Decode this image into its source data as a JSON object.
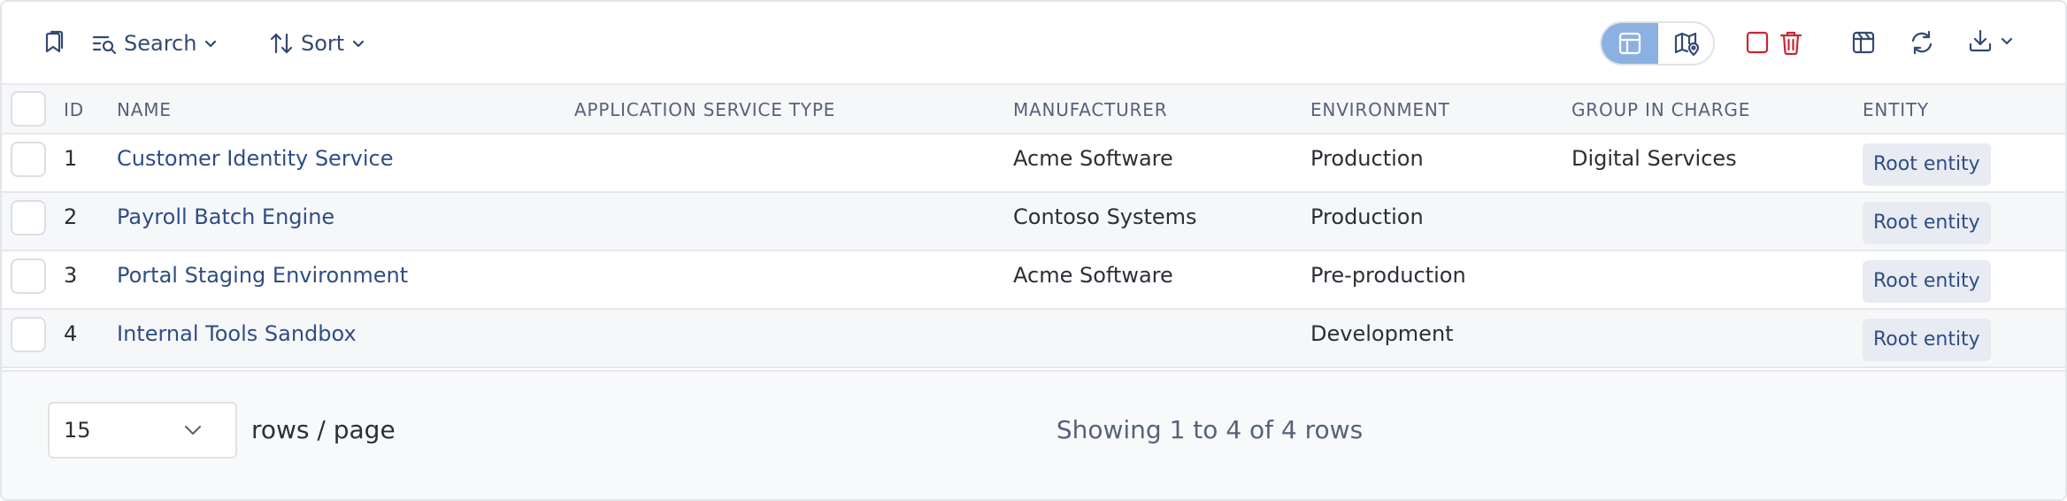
{
  "toolbar": {
    "bookmark_icon": "bookmark-icon",
    "search_label": "Search",
    "sort_label": "Sort",
    "view_toggle": {
      "active": "table-view",
      "options": [
        "table-view-icon",
        "map-view-icon"
      ],
      "active_color": "#8cb0e2"
    },
    "select_all_icon": "checkbox-outline-icon",
    "delete_icon": "trash-icon",
    "delete_color": "#c9262e",
    "columns_icon": "columns-icon",
    "refresh_icon": "refresh-icon",
    "download_icon": "download-icon"
  },
  "table": {
    "headers": {
      "id": "ID",
      "name": "NAME",
      "service_type": "APPLICATION SERVICE TYPE",
      "manufacturer": "MANUFACTURER",
      "environment": "ENVIRONMENT",
      "group": "GROUP IN CHARGE",
      "entity": "ENTITY"
    },
    "rows": [
      {
        "id": "1",
        "name": "Customer Identity Service",
        "service_type": "",
        "manufacturer": "Acme Software",
        "environment": "Production",
        "group": "Digital Services",
        "entity": "Root entity"
      },
      {
        "id": "2",
        "name": "Payroll Batch Engine",
        "service_type": "",
        "manufacturer": "Contoso Systems",
        "environment": "Production",
        "group": "",
        "entity": "Root entity"
      },
      {
        "id": "3",
        "name": "Portal Staging Environment",
        "service_type": "",
        "manufacturer": "Acme Software",
        "environment": "Pre-production",
        "group": "",
        "entity": "Root entity"
      },
      {
        "id": "4",
        "name": "Internal Tools Sandbox",
        "service_type": "",
        "manufacturer": "",
        "environment": "Development",
        "group": "",
        "entity": "Root entity"
      }
    ]
  },
  "footer": {
    "rows_per_page": "15",
    "rows_label": "rows / page",
    "showing": "Showing 1 to 4 of 4 rows"
  }
}
